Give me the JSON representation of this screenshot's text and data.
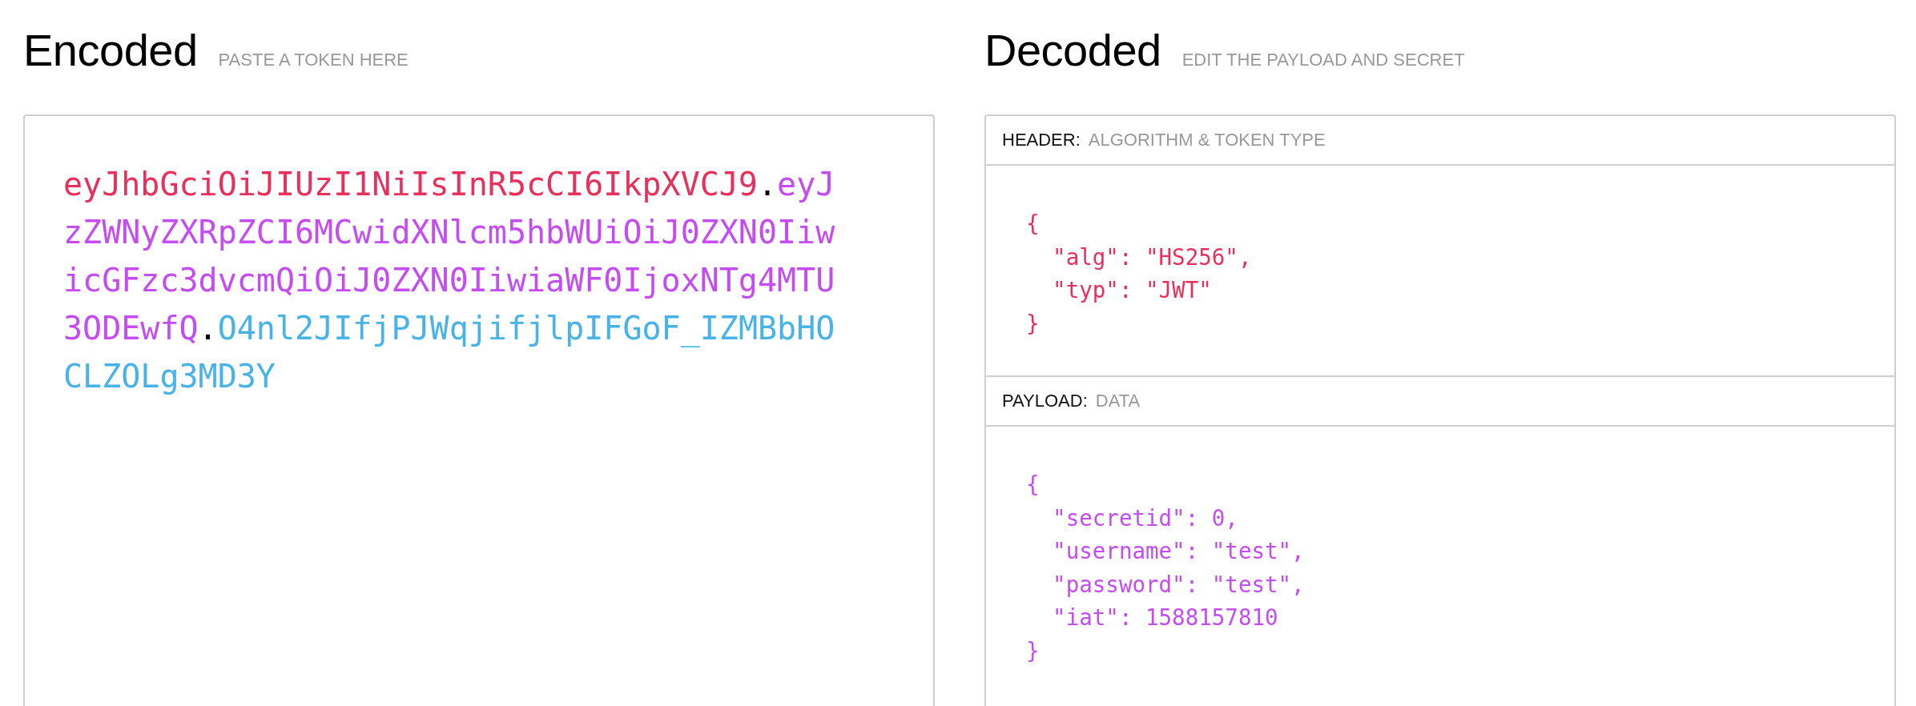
{
  "encoded": {
    "title": "Encoded",
    "hint": "PASTE A TOKEN HERE",
    "token": [
      {
        "kind": "header",
        "text": "eyJhbGciOiJIUzI1NiIsInR5cCI6IkpXVCJ9",
        "color": "#e7305c"
      },
      {
        "kind": "separator",
        "text": "."
      },
      {
        "kind": "payload",
        "text": "eyJzZWNyZXRpZCI6MCwidXNlcm5hbWUiOiJ0ZXN0IiwicGFzc3dvcmQiOiJ0ZXN0IiwiaWF0IjoxNTg4MTU3ODEwfQ",
        "color": "#c54bf2"
      },
      {
        "kind": "separator",
        "text": "."
      },
      {
        "kind": "signature",
        "text": "O4nl2JIfjPJWqjifjlpIFGoF_IZMBbHOCLZOLg3MD3Y",
        "color": "#47b3e8"
      }
    ]
  },
  "decoded": {
    "title": "Decoded",
    "hint": "EDIT THE PAYLOAD AND SECRET",
    "sections": [
      {
        "label": "HEADER:",
        "hint": "ALGORITHM & TOKEN TYPE",
        "color": "#e7305c",
        "code": {
          "open": "{",
          "entries": [
            "\"alg\": \"HS256\",",
            "\"typ\": \"JWT\""
          ],
          "close": "}"
        }
      },
      {
        "label": "PAYLOAD:",
        "hint": "DATA",
        "color": "#c54bf2",
        "code": {
          "open": "{",
          "entries": [
            "\"secretid\": 0,",
            "\"username\": \"test\",",
            "\"password\": \"test\",",
            "\"iat\": 1588157810"
          ],
          "close": "}"
        }
      }
    ]
  }
}
